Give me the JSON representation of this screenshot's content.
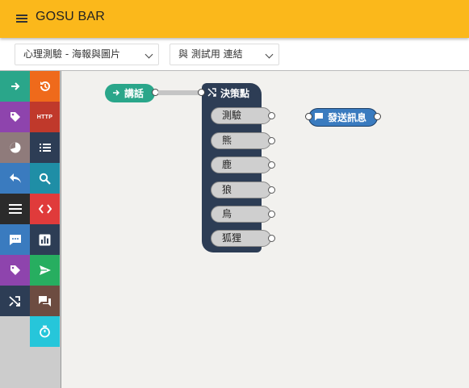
{
  "header": {
    "title": "GOSU BAR",
    "menu_icon": "hamburger-menu-icon",
    "bg_color": "#fbb81b"
  },
  "toolbar": {
    "project_select": {
      "value": "心理測驗 - 海報與圖片"
    },
    "link_select": {
      "value": "與 測試用 連結"
    }
  },
  "toolbox": {
    "items": [
      {
        "icon": "arrow-right-icon",
        "color": "#2aa68a"
      },
      {
        "icon": "history-icon",
        "color": "#ef6a1b"
      },
      {
        "icon": "tag-icon",
        "color": "#8e44ad"
      },
      {
        "icon": "http-icon",
        "label": "HTTP",
        "color": "#c0392b"
      },
      {
        "icon": "pie-chart-icon",
        "color": "#8f7b7b"
      },
      {
        "icon": "list-icon",
        "color": "#2d3d55"
      },
      {
        "icon": "reply-icon",
        "color": "#3a7bbf"
      },
      {
        "icon": "search-icon",
        "color": "#1f8ea6"
      },
      {
        "icon": "menu-lines-icon",
        "color": "#2b2b2b"
      },
      {
        "icon": "code-icon",
        "color": "#e03b3b"
      },
      {
        "icon": "chat-dots-icon",
        "color": "#3a7bbf"
      },
      {
        "icon": "bar-chart-icon",
        "color": "#2d3d55"
      },
      {
        "icon": "tag-icon",
        "color": "#8e44ad"
      },
      {
        "icon": "send-icon",
        "color": "#27ae60"
      },
      {
        "icon": "shuffle-icon",
        "color": "#2d3d55"
      },
      {
        "icon": "forum-icon",
        "color": "#6d4c41"
      },
      {
        "icon": "timer-icon",
        "color": "#26c6da"
      }
    ]
  },
  "canvas": {
    "talk_block": {
      "label": "講話",
      "color": "#2aa68a"
    },
    "decision_block": {
      "label": "決策點",
      "color": "#2d3d55",
      "options": [
        "測驗",
        "熊",
        "鹿",
        "狼",
        "烏",
        "狐狸"
      ]
    },
    "send_block": {
      "label": "發送訊息",
      "color": "#3a7bbf"
    }
  }
}
